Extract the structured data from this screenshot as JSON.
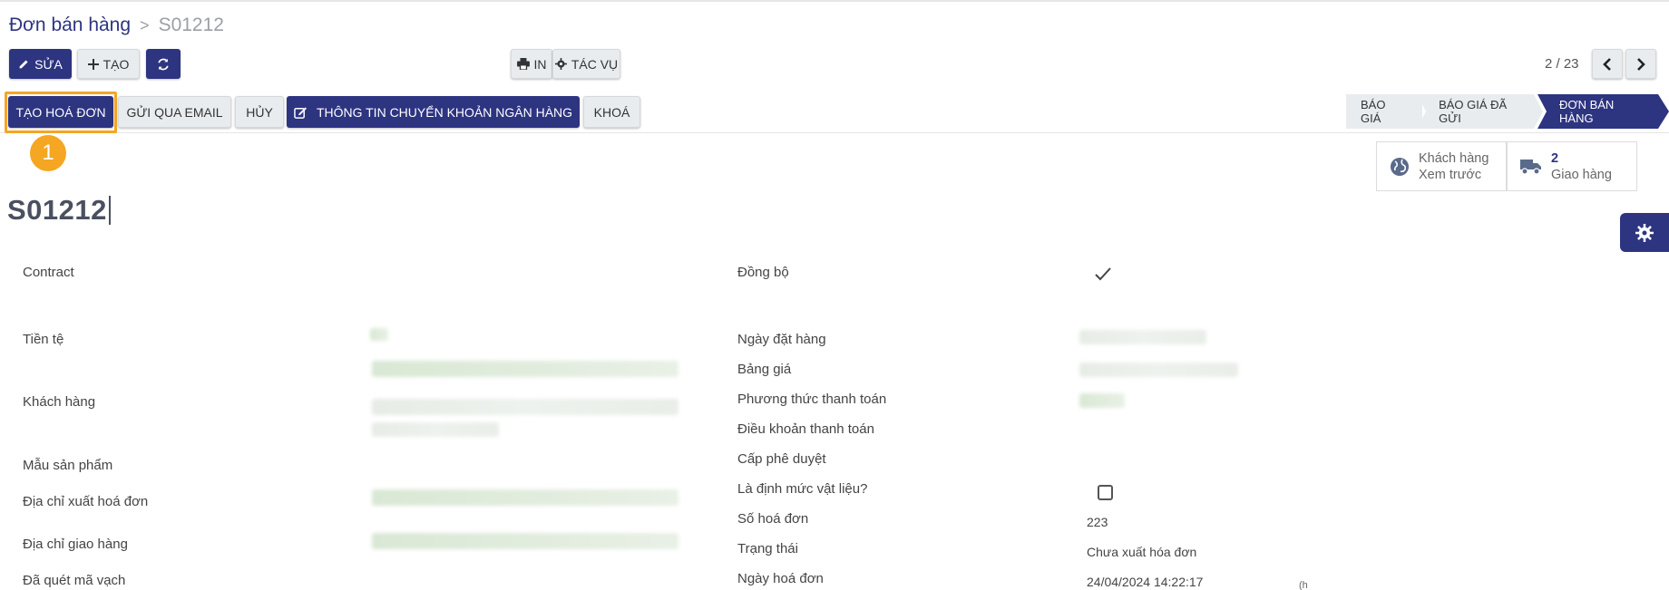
{
  "breadcrumb": {
    "parent": "Đơn bán hàng",
    "separator": ">",
    "current": "S01212"
  },
  "toolbar": {
    "edit_label": "SỬA",
    "create_label": "TẠO",
    "print_label": "IN",
    "action_label": "TÁC VỤ"
  },
  "pager": {
    "text": "2 / 23"
  },
  "actions": {
    "create_invoice": "TẠO HOÁ ĐƠN",
    "send_email": "GỬI QUA EMAIL",
    "cancel": "HỦY",
    "bank_info": "THÔNG TIN CHUYỂN KHOẢN NGÂN HÀNG",
    "lock": "KHOÁ"
  },
  "badge": {
    "number": "1"
  },
  "stages": [
    "BÁO GIÁ",
    "BÁO GIÁ ĐÃ GỬI",
    "ĐƠN BÁN HÀNG"
  ],
  "smart_buttons": {
    "customer": {
      "line1": "Khách hàng",
      "line2": "Xem trước"
    },
    "delivery": {
      "count": "2",
      "label": "Giao hàng"
    }
  },
  "record": {
    "name": "S01212"
  },
  "form_left": {
    "contract": "Contract",
    "currency": "Tiền tệ",
    "customer": "Khách hàng",
    "product_template": "Mẫu sản phẩm",
    "invoice_address": "Địa chỉ xuất hoá đơn",
    "delivery_address": "Địa chỉ giao hàng",
    "barcode_scanned": "Đã quét mã vạch"
  },
  "form_right": {
    "sync": "Đồng bộ",
    "order_date": "Ngày đặt hàng",
    "pricelist": "Bảng giá",
    "payment_method": "Phương thức thanh toán",
    "payment_terms": "Điều khoản thanh toán",
    "approval_level": "Cấp phê duyệt",
    "is_bom": "Là định mức vật liệu?",
    "invoice_number": "Số hoá đơn",
    "status": "Trạng thái",
    "invoice_date": "Ngày hoá đơn"
  },
  "form_values": {
    "invoice_number": "223",
    "status": "Chưa xuất hóa đơn",
    "invoice_date": "24/04/2024 14:22:17",
    "trailing": "(h"
  },
  "colors": {
    "primary": "#2d3480",
    "highlight": "#f5a623"
  }
}
